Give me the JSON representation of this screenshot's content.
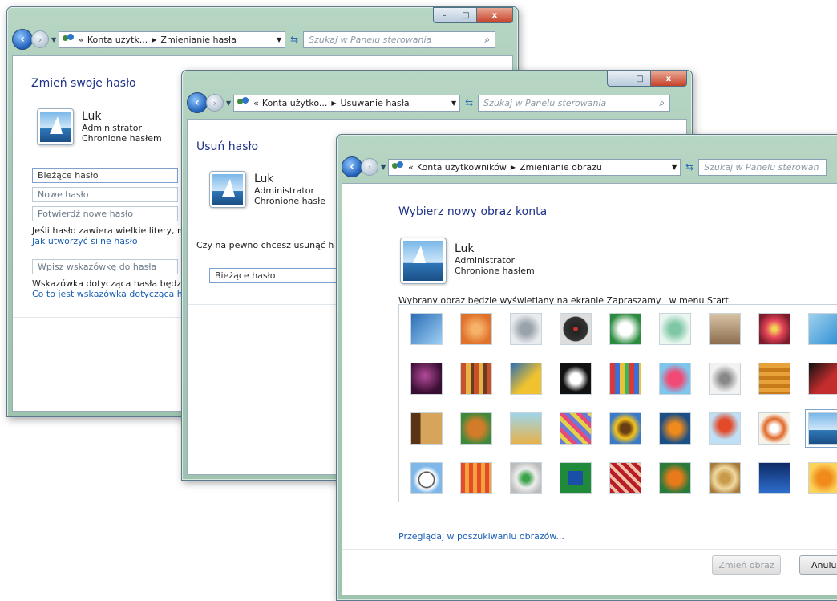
{
  "windows": [
    {
      "breadcrumb_prefix": "«",
      "breadcrumb": [
        "Konta użytk...",
        "Zmienianie hasła"
      ],
      "search_placeholder": "Szukaj w Panelu sterowania",
      "heading": "Zmień swoje hasło",
      "user": {
        "name": "Luk",
        "role": "Administrator",
        "status": "Chronione hasłem"
      },
      "fields": [
        "Bieżące hasło",
        "Nowe hasło",
        "Potwierdź nowe hasło"
      ],
      "info": "Jeśli hasło zawiera wielkie litery, mus",
      "link1": "Jak utworzyć silne hasło",
      "hint_field": "Wpisz wskazówkę do hasła",
      "hint_info": "Wskazówka dotycząca hasła będzie v",
      "link2": "Co to jest wskazówka dotycząca has"
    },
    {
      "breadcrumb_prefix": "«",
      "breadcrumb": [
        "Konta użytko...",
        "Usuwanie hasła"
      ],
      "search_placeholder": "Szukaj w Panelu sterowania",
      "heading": "Usuń hasło",
      "user": {
        "name": "Luk",
        "role": "Administrator",
        "status": "Chronione hasłe"
      },
      "question": "Czy na pewno chcesz usunąć h",
      "field": "Bieżące hasło"
    },
    {
      "breadcrumb_prefix": "«",
      "breadcrumb": [
        "Konta użytkowników",
        "Zmienianie obrazu"
      ],
      "search_placeholder": "Szukaj w Panelu sterowan",
      "heading": "Wybierz nowy obraz konta",
      "user": {
        "name": "Luk",
        "role": "Administrator",
        "status": "Chronione hasłem"
      },
      "description": "Wybrany obraz będzie wyświetlany na ekranie Zapraszamy i w menu Start.",
      "browse_link": "Przeglądaj w poszukiwaniu obrazów...",
      "change_button": "Zmień obraz",
      "cancel_button": "Anulu",
      "pictures": [
        [
          "roller-coaster",
          "starfish",
          "robot",
          "vinyl-record",
          "lucky-cat",
          "compass",
          "kitten",
          "flower-pink",
          "pinwheel"
        ],
        [
          "ball-purple",
          "fabric",
          "leaf",
          "dog-black-white",
          "crayons",
          "starburst",
          "jacks",
          "stairs",
          "origami-crane"
        ],
        [
          "guitar",
          "pomeranian",
          "robot-toy",
          "scarf",
          "sunflower",
          "fish",
          "hot-air-balloon",
          "doll",
          "sailboat"
        ],
        [
          "soccer-ball",
          "fabric-stripes",
          "marbles",
          "window-green",
          "pattern",
          "butterfly",
          "shell-spiral",
          "lighthouse",
          "orange-flower"
        ]
      ],
      "selected_picture": "sailboat"
    }
  ],
  "caption_buttons": {
    "minimize": "–",
    "maximize": "□",
    "close": "x"
  }
}
